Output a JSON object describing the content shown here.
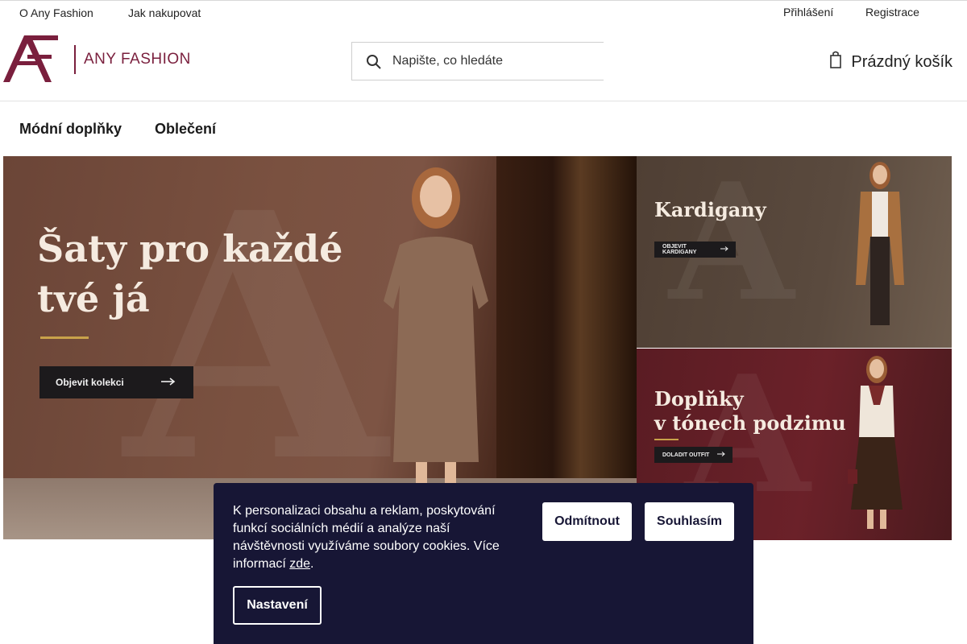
{
  "topbar": {
    "about": "O Any Fashion",
    "how_to_shop": "Jak nakupovat",
    "login": "Přihlášení",
    "register": "Registrace"
  },
  "header": {
    "logo_text": "ANY FASHION",
    "logo_monogram": "AF",
    "search_placeholder": "Napište, co hledáte",
    "search_icon": "search-icon",
    "cart_label": "Prázdný košík",
    "cart_icon": "cart-icon"
  },
  "nav": {
    "items": [
      {
        "label": "Módní doplňky"
      },
      {
        "label": "Oblečení"
      }
    ]
  },
  "hero": {
    "title_line1": "Šaty pro každé",
    "title_line2": "tvé já",
    "cta": "Objevit kolekci"
  },
  "cards": [
    {
      "title_line1": "Kardigany",
      "title_line2": "",
      "cta": "OBJEVIT KARDIGANY"
    },
    {
      "title_line1": "Doplňky",
      "title_line2": "v tónech podzimu",
      "cta": "DOLADIT OUTFIT"
    }
  ],
  "cookie": {
    "text": "K personalizaci obsahu a reklam, poskytování funkcí sociálních médií a analýze naší návštěvnosti využíváme soubory cookies. Více informací ",
    "link": "zde",
    "text_end": ".",
    "reject": "Odmítnout",
    "accept": "Souhlasím",
    "settings": "Nastavení"
  },
  "colors": {
    "brand": "#7a1f3d",
    "cookie_bg": "#171635",
    "accent_gold": "#c9a24a"
  }
}
